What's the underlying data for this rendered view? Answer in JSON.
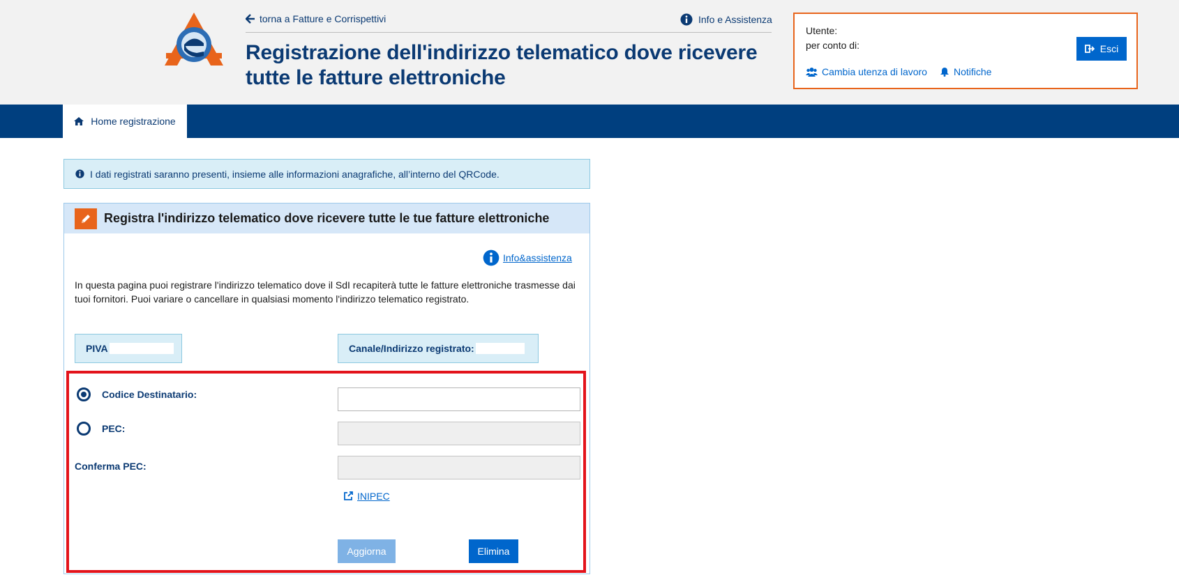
{
  "header": {
    "back_link": "torna a Fatture e Corrispettivi",
    "info_link": "Info e Assistenza",
    "title": "Registrazione dell'indirizzo telematico dove ricevere tutte le fatture elettroniche"
  },
  "user": {
    "utente_label": "Utente:",
    "per_conto_label": "per conto di:",
    "esci_label": "Esci",
    "cambia_label": "Cambia utenza di lavoro",
    "notifiche_label": "Notifiche"
  },
  "nav": {
    "home_tab": "Home registrazione"
  },
  "alert": {
    "text": "I dati registrati saranno presenti, insieme alle informazioni anagrafiche, all’interno del QRCode."
  },
  "panel": {
    "title": "Registra l'indirizzo telematico dove ricevere tutte le tue fatture elettroniche",
    "info_link": "Info&assistenza",
    "intro": "In questa pagina puoi registrare l'indirizzo telematico dove il SdI recapiterà tutte le fatture elettroniche trasmesse dai tuoi fornitori. Puoi variare o cancellare in qualsiasi momento l'indirizzo telematico registrato.",
    "piva_label": "PIVA",
    "canale_label": "Canale/Indirizzo registrato:"
  },
  "form": {
    "codice_label": "Codice Destinatario:",
    "codice_value": "",
    "pec_label": "PEC:",
    "pec_value": "",
    "conferma_label": "Conferma PEC:",
    "conferma_value": "",
    "selected_option": "codice",
    "inipec_link": "INIPEC",
    "aggiorna_label": "Aggiorna",
    "elimina_label": "Elimina"
  },
  "colors": {
    "brand_blue": "#003f7f",
    "accent_orange": "#e8641b",
    "highlight_red": "#e3131b",
    "button_blue": "#0066cc"
  }
}
